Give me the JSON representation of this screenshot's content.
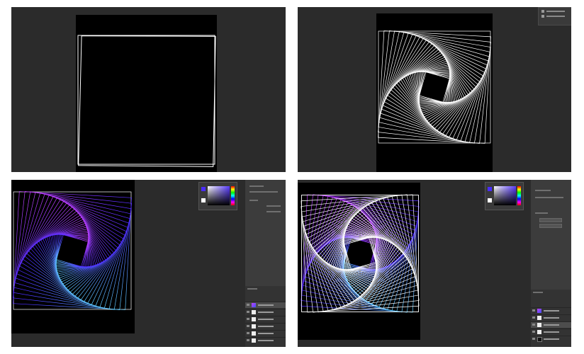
{
  "panels": [
    {
      "id": "step1",
      "description_label": ""
    },
    {
      "id": "step2",
      "description_label": ""
    },
    {
      "id": "step3",
      "description_label": ""
    },
    {
      "id": "step4",
      "description_label": ""
    }
  ],
  "colors": {
    "workspace": "#2b2b2b",
    "canvas": "#000000",
    "stroke_white": "#ffffff",
    "gradient_top": "#c040ff",
    "gradient_mid": "#4a2cff",
    "gradient_bottom": "#5fd0ff"
  },
  "icons": [
    "visibility-eye-icon",
    "layer-thumbnail-icon",
    "color-picker-icon"
  ]
}
